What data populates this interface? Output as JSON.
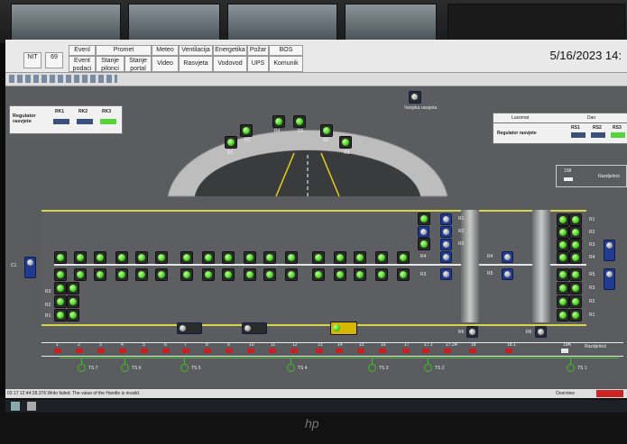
{
  "menu": {
    "row1": [
      "Evenl",
      "Promet",
      "Meteo",
      "Ventilacija",
      "Energetika",
      "Požar",
      "BOS"
    ],
    "row2": [
      "Event podaci",
      "Stanje pilonci",
      "Stanje portal",
      "Video",
      "Rasvjeta",
      "Vodovod",
      "UPS",
      "Komunik"
    ],
    "left_row1": [
      "NIT",
      "69"
    ]
  },
  "datetime": "5/16/2023 14:",
  "regulator_left": {
    "title": "Regulator rasvjete",
    "buttons": [
      "RK1",
      "RK2",
      "RK3"
    ]
  },
  "regulator_right": {
    "title": "Regulator rasvjete",
    "header_left": "Luxomat",
    "header_right": "Dan",
    "buttons": [
      "RS1",
      "RS2",
      "RS3"
    ]
  },
  "vanjska": "Vanjska rasvjeta",
  "razdjelnici_label": "Razdjelnici",
  "box_198": "198",
  "tunnel_labels": [
    "R1",
    "R2",
    "R3",
    "R4",
    "R5",
    "R4",
    "R5",
    "R1",
    "R2",
    "R3"
  ],
  "tube_left_labels": [
    "C1",
    "R3",
    "R2",
    "R1"
  ],
  "tube_right_labels": [
    "R1",
    "R2",
    "R3",
    "R4",
    "R5",
    "R3",
    "R2",
    "R1"
  ],
  "mid_labels": [
    "R1",
    "R2",
    "R3",
    "R4",
    "R3",
    "R4",
    "R5",
    "R6",
    "R6"
  ],
  "sections": [
    "1",
    "2",
    "3",
    "4",
    "5",
    "6",
    "7",
    "8",
    "9",
    "10",
    "11",
    "12",
    "13",
    "14",
    "15",
    "16",
    "17",
    "17.1",
    "17.2A",
    "18",
    "18.1",
    "19A"
  ],
  "ts_labels": [
    "TS 7",
    "TS 6",
    "TS 5",
    "TS 4",
    "TS 3",
    "TS 2",
    "TS 1"
  ],
  "status_message": "03 17 12:44:28.376   Writo failed. The value of the Handle is invalid.",
  "status_right": "Overview",
  "brand": "hp",
  "colors": {
    "lamp_on": "#3fd01a",
    "lamp_off": "#9a9a9a",
    "section_alarm": "#cc1d1d",
    "rail": "#d6d64a",
    "canvas": "#5b5c5f"
  }
}
